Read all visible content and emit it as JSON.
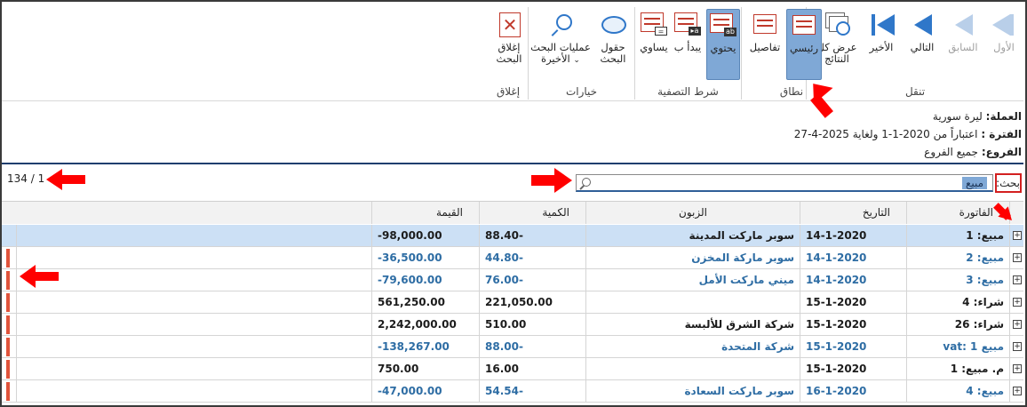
{
  "ribbon": {
    "groups": [
      {
        "key": "navigate",
        "label": "تنقل",
        "buttons": [
          {
            "label": "الأول",
            "icon": "first-icon",
            "disabled": true
          },
          {
            "label": "السابق",
            "icon": "previous-icon",
            "disabled": true
          },
          {
            "label": "التالي",
            "icon": "next-icon",
            "disabled": false
          },
          {
            "label": "الأخير",
            "icon": "last-icon",
            "disabled": false
          },
          {
            "label": "عرض كل النتائج",
            "icon": "show-all-results-icon",
            "disabled": false
          }
        ]
      },
      {
        "key": "scope",
        "label": "نطاق",
        "buttons": [
          {
            "label": "رئيسي",
            "icon": "main-scope-icon",
            "selected": true
          },
          {
            "label": "تفاصيل",
            "icon": "details-scope-icon",
            "selected": false
          }
        ]
      },
      {
        "key": "filter",
        "label": "شرط التصفية",
        "buttons": [
          {
            "label": "يحتوي",
            "icon": "contains-icon",
            "selected": true
          },
          {
            "label": "يبدأ ب",
            "icon": "starts-with-icon",
            "selected": false
          },
          {
            "label": "يساوي",
            "icon": "equals-icon",
            "selected": false
          }
        ]
      },
      {
        "key": "options",
        "label": "خيارات",
        "buttons": [
          {
            "label": "حقول البحث",
            "icon": "search-fields-icon"
          },
          {
            "label": "عمليات البحث الأخيرة",
            "icon": "recent-searches-icon"
          }
        ]
      },
      {
        "key": "close",
        "label": "إغلاق",
        "buttons": [
          {
            "label": "إغلاق البحث",
            "icon": "close-search-icon"
          }
        ]
      }
    ]
  },
  "info": {
    "currency_label": "العملة:",
    "currency_value": "ليرة سورية",
    "period_label": "الفترة :",
    "period_value": "اعتباراً من 2020-1-1 ولغاية 2025-4-27",
    "branches_label": "الفروع:",
    "branches_value": "جميع الفروع"
  },
  "search": {
    "label": "بحث:",
    "value": "مبيع",
    "counter": "134 / 1"
  },
  "table": {
    "headers": {
      "invoice": "الفاتورة",
      "date": "التاريخ",
      "customer": "الزبون",
      "quantity": "الكمية",
      "value": "القيمة"
    },
    "rows": [
      {
        "invoice": "مبيع: 1",
        "date": "14-1-2020",
        "customer": "سوبر ماركت المدينة",
        "quantity": "88.40-",
        "value": "-98,000.00",
        "color": "black",
        "selected": true
      },
      {
        "invoice": "مبيع: 2",
        "date": "14-1-2020",
        "customer": "سوبر ماركة المخزن",
        "quantity": "44.80-",
        "value": "-36,500.00",
        "color": "blue",
        "selected": false
      },
      {
        "invoice": "مبيع: 3",
        "date": "14-1-2020",
        "customer": "ميني ماركت الأمل",
        "quantity": "76.00-",
        "value": "-79,600.00",
        "color": "blue",
        "selected": false
      },
      {
        "invoice": "شراء: 4",
        "date": "15-1-2020",
        "customer": "",
        "quantity": "221,050.00",
        "value": "561,250.00",
        "color": "black",
        "selected": false
      },
      {
        "invoice": "شراء: 26",
        "date": "15-1-2020",
        "customer": "شركة الشرق للألبسة",
        "quantity": "510.00",
        "value": "2,242,000.00",
        "color": "black",
        "selected": false
      },
      {
        "invoice": "مبيع vat: 1",
        "date": "15-1-2020",
        "customer": "شركة المتحدة",
        "quantity": "88.00-",
        "value": "-138,267.00",
        "color": "blue",
        "selected": false
      },
      {
        "invoice": "م. مبيع: 1",
        "date": "15-1-2020",
        "customer": "",
        "quantity": "16.00",
        "value": "750.00",
        "color": "black",
        "selected": false
      },
      {
        "invoice": "مبيع: 4",
        "date": "16-1-2020",
        "customer": "سوبر ماركت السعادة",
        "quantity": "54.54-",
        "value": "-47,000.00",
        "color": "blue",
        "selected": false
      }
    ]
  },
  "colors": {
    "accent": "#2f77c9",
    "selected_button": "#7fa8d6",
    "selected_row": "#cce0f5",
    "link_text": "#2e6da4",
    "annotation_arrow": "#ff0000"
  }
}
